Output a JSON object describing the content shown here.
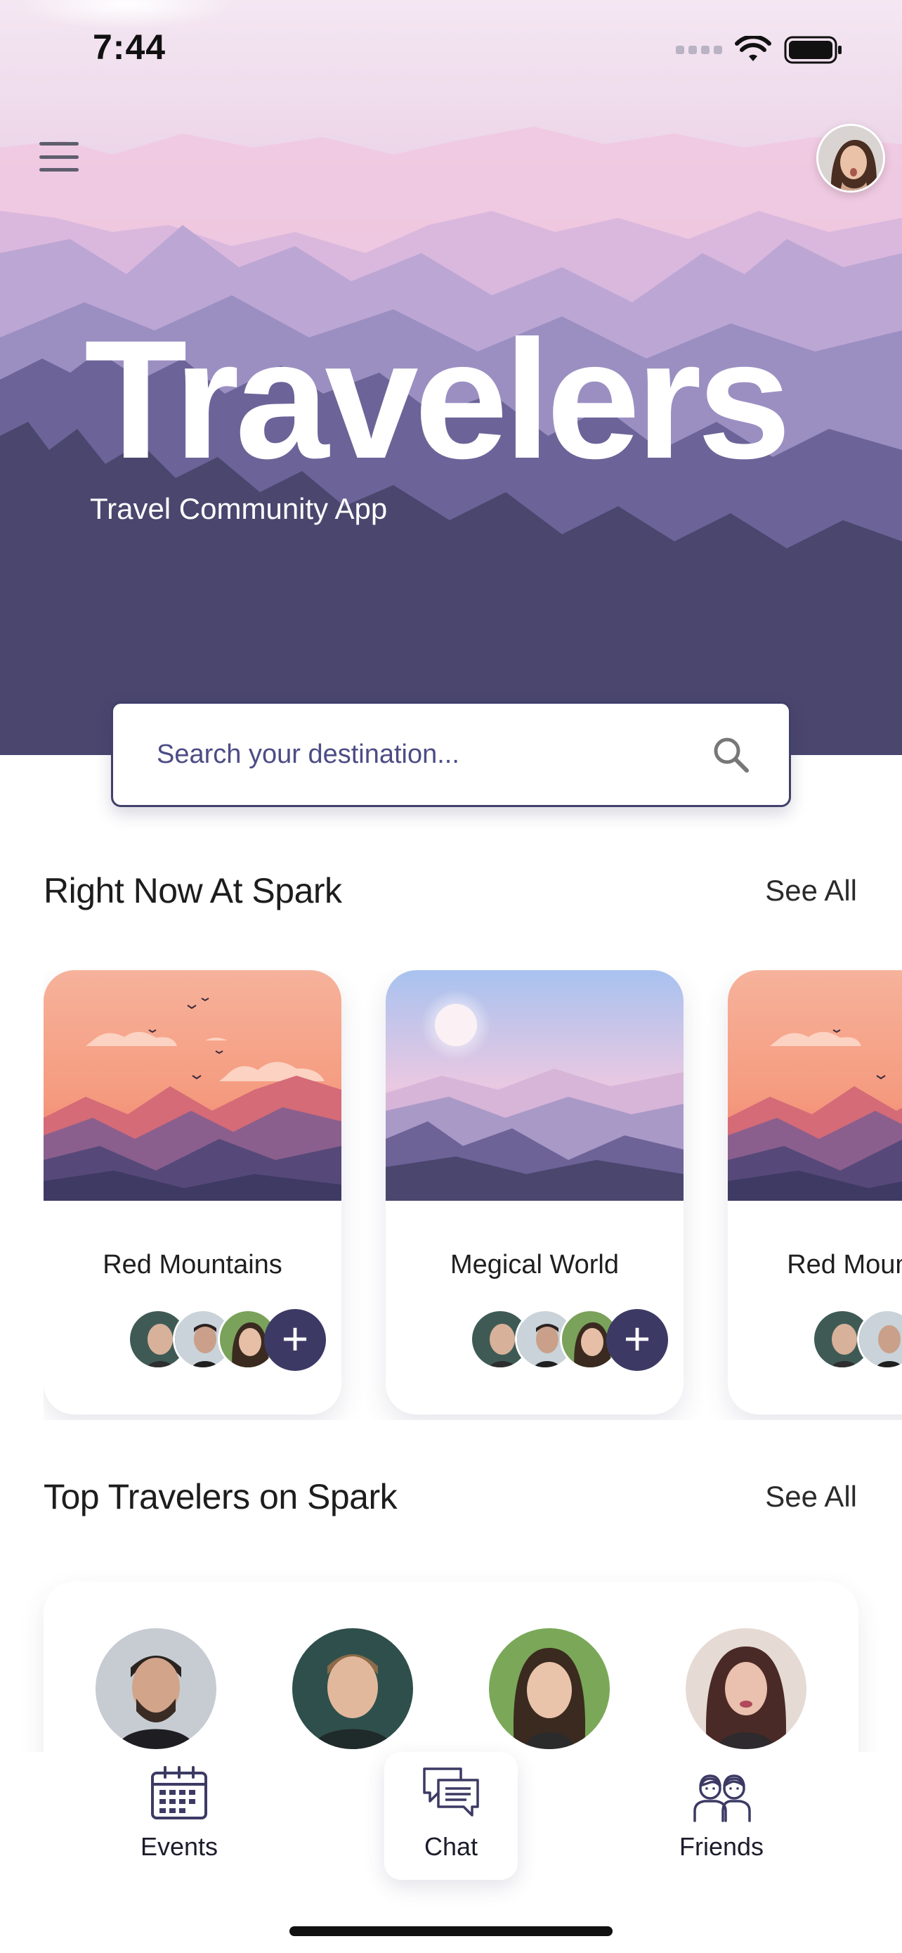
{
  "status_bar": {
    "time": "7:44"
  },
  "header": {
    "menu_icon": "hamburger-icon",
    "profile_avatar_icon": "profile-avatar"
  },
  "hero": {
    "title": "Travelers",
    "subtitle": "Travel Community App"
  },
  "search": {
    "placeholder": "Search your destination...",
    "icon": "search-icon"
  },
  "right_now": {
    "title": "Right Now At Spark",
    "see_all": "See All",
    "cards": [
      {
        "title": "Red Mountains",
        "add_label": "+"
      },
      {
        "title": "Megical World",
        "add_label": "+"
      },
      {
        "title": "Red Mountains",
        "add_label": "+"
      }
    ]
  },
  "top_travelers": {
    "title": "Top Travelers on Spark",
    "see_all": "See All"
  },
  "bottom_nav": {
    "items": [
      {
        "label": "Events",
        "icon": "calendar-icon"
      },
      {
        "label": "Chat",
        "icon": "chat-icon"
      },
      {
        "label": "Friends",
        "icon": "friends-icon"
      }
    ]
  },
  "colors": {
    "primary": "#3c3a64",
    "hero_dark": "#4a466e",
    "sunset": "#f39a7e"
  }
}
